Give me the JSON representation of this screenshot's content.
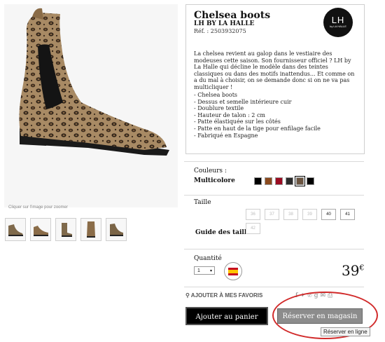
{
  "product": {
    "title": "Chelsea boots",
    "brand": "LH BY LA HALLE",
    "ref": "Réf. : 2503932075",
    "logo_big": "LH",
    "logo_small": "by LA HALLE",
    "description": "La chelsea revient au galop dans le vestiaire des modeuses cette saison. Son fournisseur officiel ? LH by La Halle qui décline le modèle dans des teintes classiques ou dans des motifs inattendus... Et comme on a du mal à choisir, on se demande donc si on ne va pas multicliquer !",
    "features": [
      "- Chelsea boots",
      "- Dessus et semelle intérieure cuir",
      "- Doublure textile",
      "- Hauteur de talon : 2 cm",
      "- Patte élastiquée sur les côtés",
      "- Patte en haut de la tige pour enfilage facile",
      "- Fabriqué en Espagne"
    ]
  },
  "gallery": {
    "zoom_hint": "Cliquer sur l'image pour zoomer",
    "thumbnail_count": 5
  },
  "colors": {
    "label": "Couleurs :",
    "selected": "Multicolore",
    "swatches": [
      "#000000",
      "#8b4a1e",
      "#9b0c22",
      "#2b2b2b",
      "#6b5440",
      "#000000"
    ]
  },
  "sizes": {
    "label": "Taille",
    "guide": "Guide des tailles",
    "row1": [
      "36",
      "37",
      "38",
      "39",
      "40",
      "41"
    ],
    "row2": [
      "42"
    ]
  },
  "quantity": {
    "label": "Quantité",
    "value": "1"
  },
  "made_in": "MADE IN SPAIN",
  "price": {
    "amount": "39",
    "currency": "€"
  },
  "favorites": "AJOUTER À MES FAVORIS",
  "actions": {
    "cart": "Ajouter au panier",
    "store": "Réserver en magasin",
    "tooltip": "Réserver en ligne"
  },
  "colors_theme": {
    "accent": "#d12a2a",
    "button_dark": "#000000",
    "button_grey": "#8c8c8c"
  }
}
